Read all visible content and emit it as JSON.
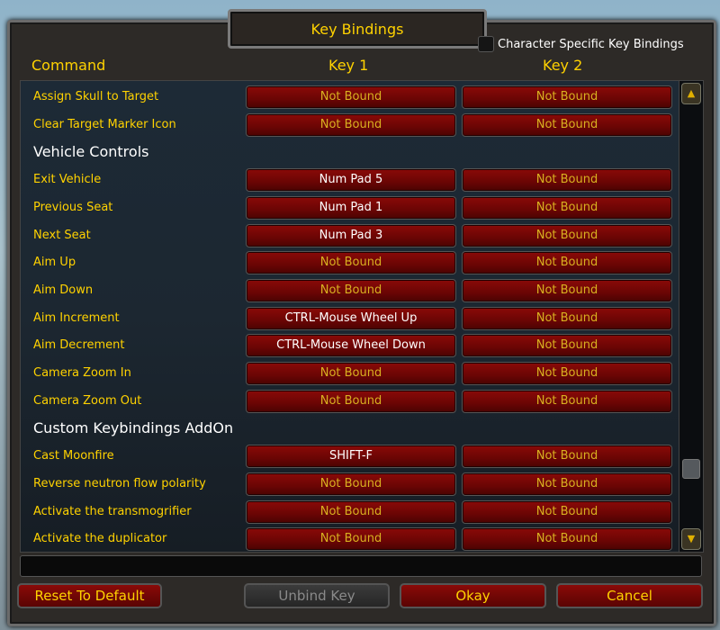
{
  "title": "Key Bindings",
  "character_specific": {
    "label": "Character Specific Key Bindings",
    "checked": false
  },
  "columns": {
    "command": "Command",
    "key1": "Key 1",
    "key2": "Key 2"
  },
  "rows": [
    {
      "type": "binding",
      "command": "Assign Skull to Target",
      "key1": "Not Bound",
      "key2": "Not Bound"
    },
    {
      "type": "binding",
      "command": "Clear Target Marker Icon",
      "key1": "Not Bound",
      "key2": "Not Bound"
    },
    {
      "type": "header",
      "command": "Vehicle Controls"
    },
    {
      "type": "binding",
      "command": "Exit Vehicle",
      "key1": "Num Pad 5",
      "key2": "Not Bound"
    },
    {
      "type": "binding",
      "command": "Previous Seat",
      "key1": "Num Pad 1",
      "key2": "Not Bound"
    },
    {
      "type": "binding",
      "command": "Next Seat",
      "key1": "Num Pad 3",
      "key2": "Not Bound"
    },
    {
      "type": "binding",
      "command": "Aim Up",
      "key1": "Not Bound",
      "key2": "Not Bound"
    },
    {
      "type": "binding",
      "command": "Aim Down",
      "key1": "Not Bound",
      "key2": "Not Bound"
    },
    {
      "type": "binding",
      "command": "Aim Increment",
      "key1": "CTRL-Mouse Wheel Up",
      "key2": "Not Bound"
    },
    {
      "type": "binding",
      "command": "Aim Decrement",
      "key1": "CTRL-Mouse Wheel Down",
      "key2": "Not Bound"
    },
    {
      "type": "binding",
      "command": "Camera Zoom In",
      "key1": "Not Bound",
      "key2": "Not Bound"
    },
    {
      "type": "binding",
      "command": "Camera Zoom Out",
      "key1": "Not Bound",
      "key2": "Not Bound"
    },
    {
      "type": "header",
      "command": "Custom Keybindings AddOn"
    },
    {
      "type": "binding",
      "command": "Cast Moonfire",
      "key1": "SHIFT-F",
      "key2": "Not Bound"
    },
    {
      "type": "binding",
      "command": "Reverse neutron flow polarity",
      "key1": "Not Bound",
      "key2": "Not Bound"
    },
    {
      "type": "binding",
      "command": "Activate the transmogrifier",
      "key1": "Not Bound",
      "key2": "Not Bound"
    },
    {
      "type": "binding",
      "command": "Activate the duplicator",
      "key1": "Not Bound",
      "key2": "Not Bound"
    }
  ],
  "not_bound_text": "Not Bound",
  "scrollbar": {
    "position_fraction": 0.95
  },
  "buttons": {
    "reset": "Reset To Default",
    "unbind": "Unbind Key",
    "okay": "Okay",
    "cancel": "Cancel"
  },
  "colors": {
    "gold": "#ffd200",
    "button_red": "#7a0605"
  }
}
